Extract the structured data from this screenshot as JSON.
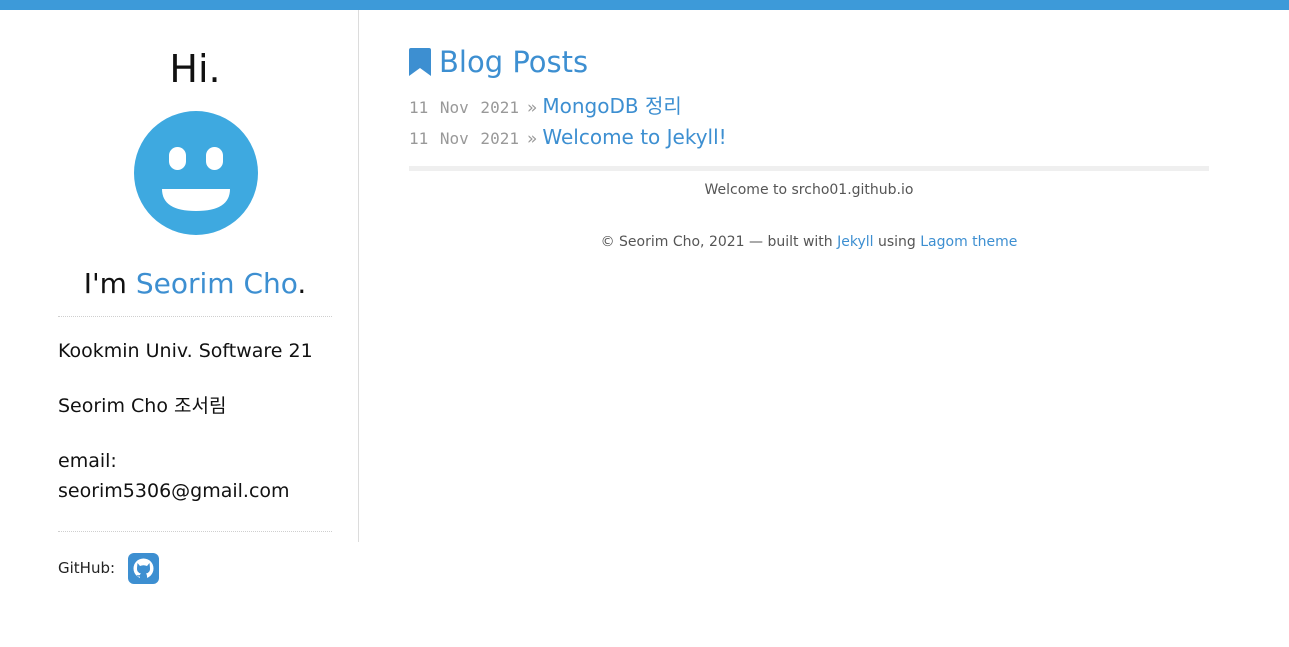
{
  "colors": {
    "accent": "#3d9ad9",
    "link": "#3d8fd1",
    "muted": "#999999"
  },
  "sidebar": {
    "greeting": "Hi.",
    "avatar_icon": "smiley-face-icon",
    "intro_prefix": "I'm ",
    "intro_name": "Seorim Cho",
    "intro_suffix": ".",
    "info": {
      "school": "Kookmin Univ. Software 21",
      "name": "Seorim Cho 조서림",
      "email_label": "email:",
      "email": "seorim5306@gmail.com"
    },
    "github_label": "GitHub:",
    "github_icon": "github-icon"
  },
  "main": {
    "heading_icon": "bookmark-icon",
    "heading": "Blog Posts",
    "posts": [
      {
        "date": "11 Nov 2021",
        "sep": "»",
        "title": "MongoDB 정리"
      },
      {
        "date": "11 Nov 2021",
        "sep": "»",
        "title": "Welcome to Jekyll!"
      }
    ],
    "welcome": "Welcome to srcho01.github.io",
    "footer": {
      "prefix": "© Seorim Cho, 2021 — built with ",
      "jekyll": "Jekyll",
      "middle": " using ",
      "theme": "Lagom theme"
    }
  }
}
